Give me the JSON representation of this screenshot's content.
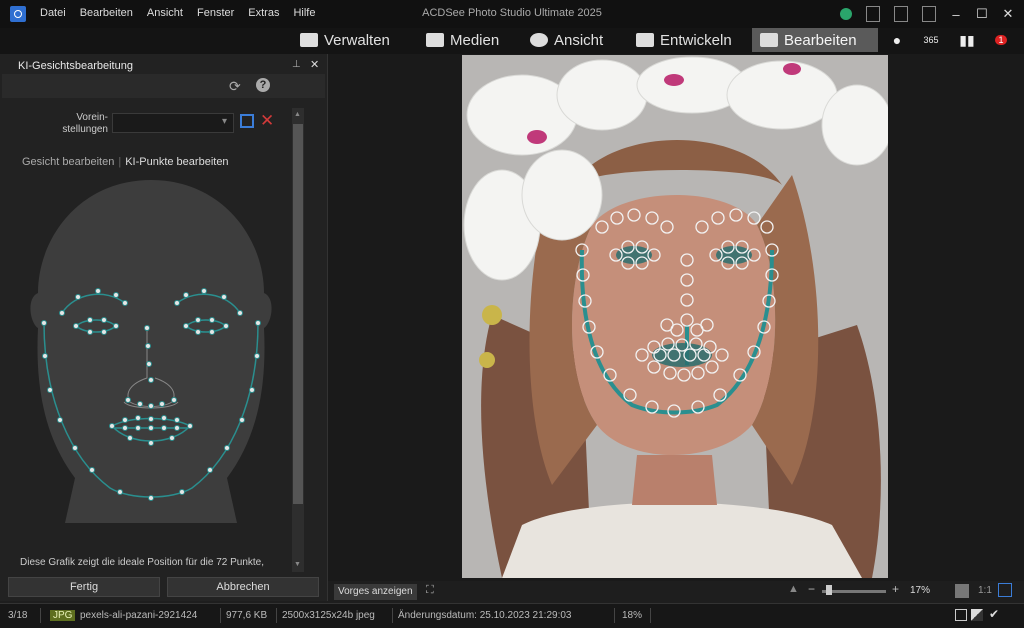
{
  "window": {
    "title": "ACDSee Photo Studio Ultimate 2025"
  },
  "menu": [
    "Datei",
    "Bearbeiten",
    "Ansicht",
    "Fenster",
    "Extras",
    "Hilfe"
  ],
  "modes": [
    {
      "label": "Verwalten",
      "icon": "grid-icon"
    },
    {
      "label": "Medien",
      "icon": "media-icon"
    },
    {
      "label": "Ansicht",
      "icon": "eye-icon"
    },
    {
      "label": "Entwickeln",
      "icon": "develop-icon"
    },
    {
      "label": "Bearbeiten",
      "icon": "tools-icon",
      "active": true
    }
  ],
  "mode_extra": {
    "cloud_label": "365",
    "badge": "1"
  },
  "panel": {
    "tab": "KI-Gesichtsbearbeitung",
    "preset_label": "Vorein-\nstellungen",
    "preset_value": "",
    "subtab_face": "Gesicht bearbeiten",
    "subtab_points": "KI-Punkte bearbeiten",
    "description": "Diese Grafik zeigt die ideale Position für die 72 Punkte,",
    "done": "Fertig",
    "cancel": "Abbrechen"
  },
  "viewer": {
    "prev_button": "Vorges anzeigen",
    "zoom": "17%",
    "ratio": "1:1"
  },
  "status": {
    "index": "3/18",
    "format": "JPG",
    "filename": "pexels-ali-pazani-2921424",
    "size": "977,6 KB",
    "dimensions": "2500x3125x24b jpeg",
    "date": "Änderungsdatum: 25.10.2023 21:29:03",
    "zoom": "18%"
  },
  "colors": {
    "accent": "#3b7dd8",
    "landmark": "#2a8f8f",
    "active_mode": "#5a5a5a"
  }
}
